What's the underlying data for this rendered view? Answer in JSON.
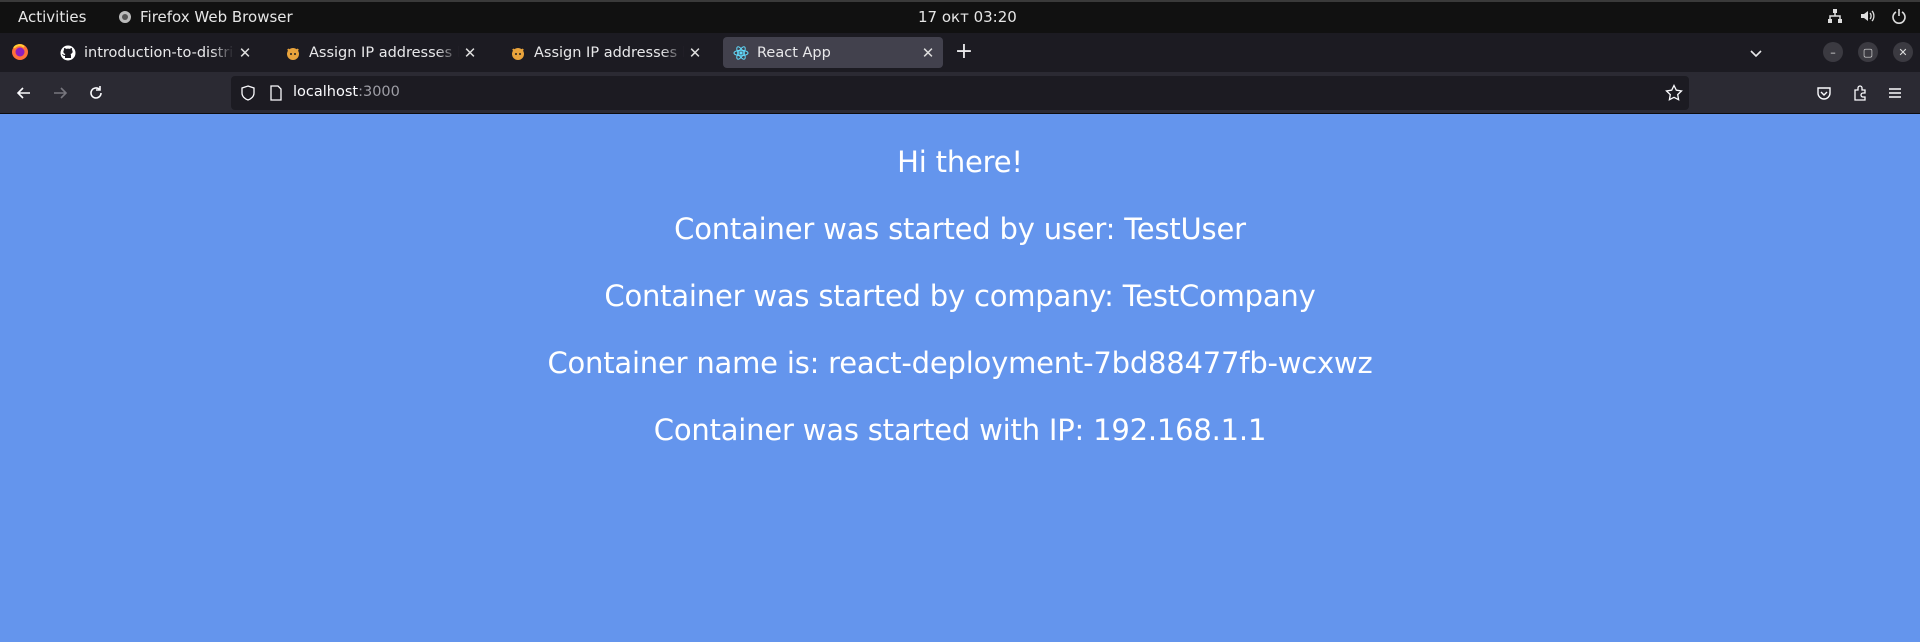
{
  "system_bar": {
    "activities": "Activities",
    "app_name": "Firefox Web Browser",
    "clock": "17 окт  03:20"
  },
  "tabs": [
    {
      "title": "introduction-to-distributed",
      "icon": "github-icon",
      "active": false
    },
    {
      "title": "Assign IP addresses based on",
      "icon": "calico-icon",
      "active": false
    },
    {
      "title": "Assign IP addresses based on",
      "icon": "calico-icon",
      "active": false
    },
    {
      "title": "React App",
      "icon": "react-icon",
      "active": true
    }
  ],
  "urlbar": {
    "host": "localhost",
    "port": ":3000"
  },
  "page": {
    "lines": [
      "Hi there!",
      "Container was started by user: TestUser",
      "Container was started by company: TestCompany",
      "Container name is: react-deployment-7bd88477fb-wcxwz",
      "Container was started with IP: 192.168.1.1"
    ]
  },
  "colors": {
    "page_background": "#6495ed",
    "page_text": "#ffffff",
    "tabstrip": "#1c1b22",
    "navbar": "#2b2a33"
  }
}
